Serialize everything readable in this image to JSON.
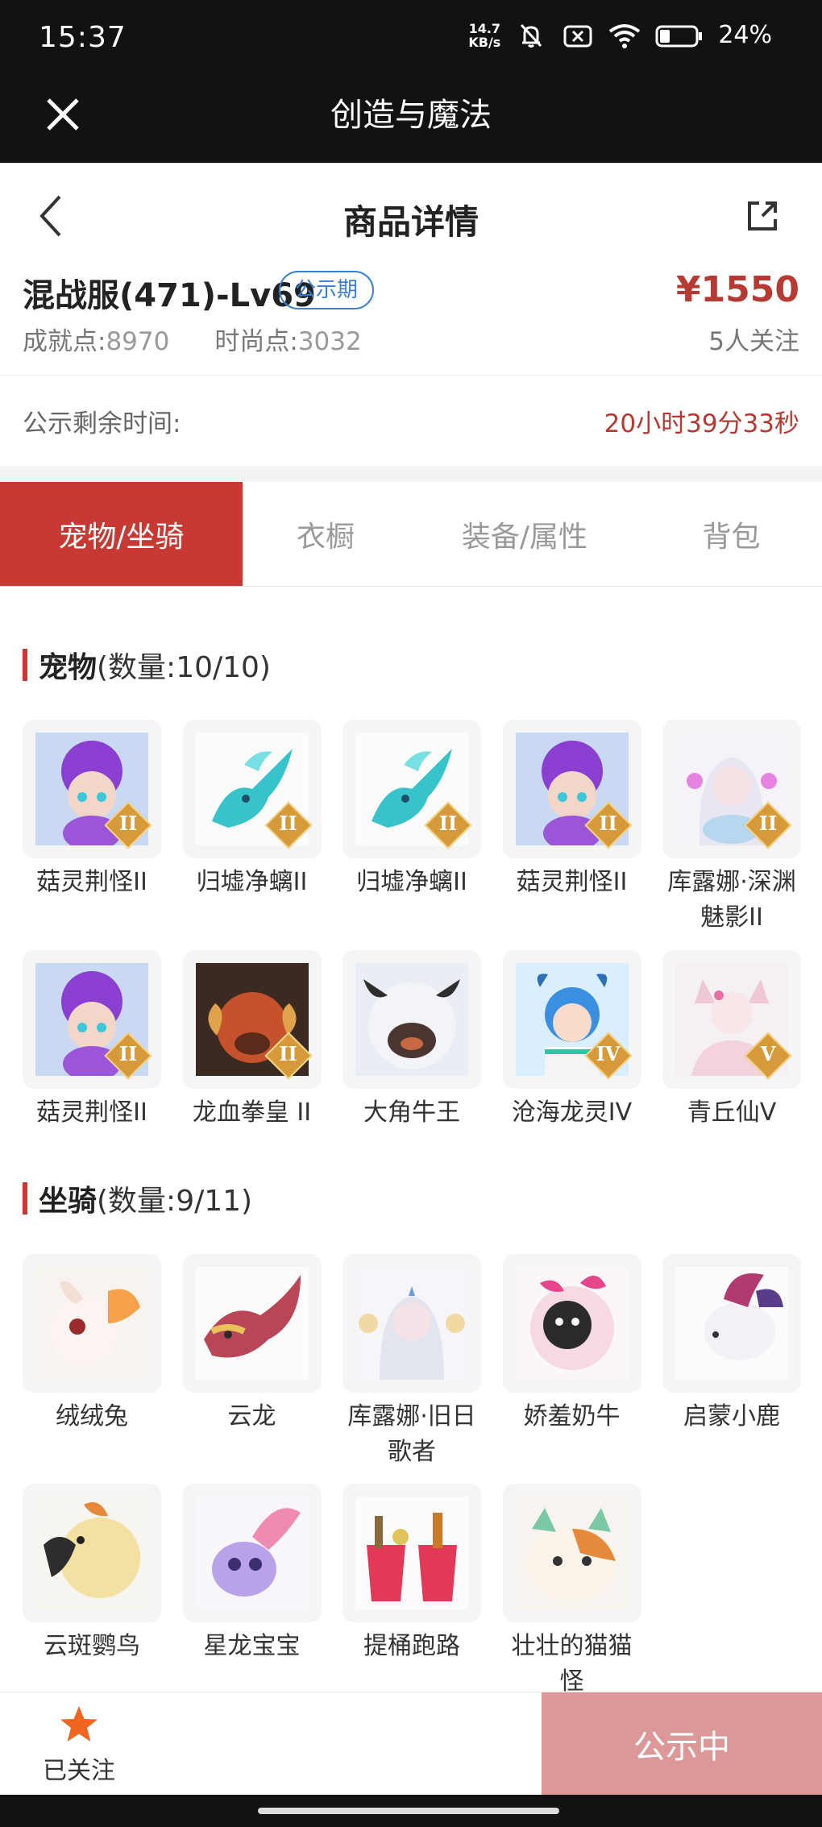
{
  "status_bar": {
    "time": "15:37",
    "net_speed_top": "14.7",
    "net_speed_unit": "KB/s",
    "battery": "24%"
  },
  "app_bar": {
    "title": "创造与魔法"
  },
  "header": {
    "title": "商品详情"
  },
  "product": {
    "server": "混战服(471)-Lv69",
    "badge": "公示期",
    "price": "¥1550",
    "achievement_label": "成就点:",
    "achievement_value": "8970",
    "fashion_label": "时尚点:",
    "fashion_value": "3032",
    "follows": "5人关注"
  },
  "remain": {
    "label": "公示剩余时间:",
    "time": "20小时39分33秒"
  },
  "tabs": [
    "宠物/坐骑",
    "衣橱",
    "装备/属性",
    "背包"
  ],
  "pets_section": {
    "name": "宠物",
    "count": "(数量:10/10)"
  },
  "pets": [
    {
      "label": "菇灵荆怪II",
      "rank": "II",
      "icon": "mushroom-pet-icon"
    },
    {
      "label": "归墟净螭II",
      "rank": "II",
      "icon": "dragon-pet-icon"
    },
    {
      "label": "归墟净螭II",
      "rank": "II",
      "icon": "dragon-pet-icon"
    },
    {
      "label": "菇灵荆怪II",
      "rank": "II",
      "icon": "mushroom-pet-icon"
    },
    {
      "label": "库露娜·深渊魅影II",
      "rank": "II",
      "icon": "fairy-pet-icon"
    },
    {
      "label": "菇灵荆怪II",
      "rank": "II",
      "icon": "mushroom-pet-icon"
    },
    {
      "label": "龙血拳皇 II",
      "rank": "II",
      "icon": "ram-pet-icon"
    },
    {
      "label": "大角牛王",
      "rank": "",
      "icon": "bull-pet-icon"
    },
    {
      "label": "沧海龙灵IV",
      "rank": "IV",
      "icon": "sea-dragon-pet-icon"
    },
    {
      "label": "青丘仙V",
      "rank": "V",
      "icon": "fox-spirit-pet-icon"
    }
  ],
  "mounts_section": {
    "name": "坐骑",
    "count": "(数量:9/11)"
  },
  "mounts": [
    {
      "label": "绒绒兔",
      "icon": "rabbit-mount-icon"
    },
    {
      "label": "云龙",
      "icon": "cloud-dragon-mount-icon"
    },
    {
      "label": "库露娜·旧日歌者",
      "icon": "singer-mount-icon"
    },
    {
      "label": "娇羞奶牛",
      "icon": "cow-mount-icon"
    },
    {
      "label": "启蒙小鹿",
      "icon": "deer-mount-icon"
    },
    {
      "label": "云斑鹦鸟",
      "icon": "parrot-mount-icon"
    },
    {
      "label": "星龙宝宝",
      "icon": "baby-dragon-mount-icon"
    },
    {
      "label": "提桶跑路",
      "icon": "bucket-mount-icon"
    },
    {
      "label": "壮壮的猫猫怪",
      "icon": "cat-mount-icon"
    }
  ],
  "bottom": {
    "follow_label": "已关注",
    "action_label": "公示中"
  },
  "colors": {
    "accent": "#c73a33",
    "price": "#b43a33",
    "badge": "#3b7fd2",
    "action_bg": "#db9896",
    "star": "#f0651f"
  }
}
